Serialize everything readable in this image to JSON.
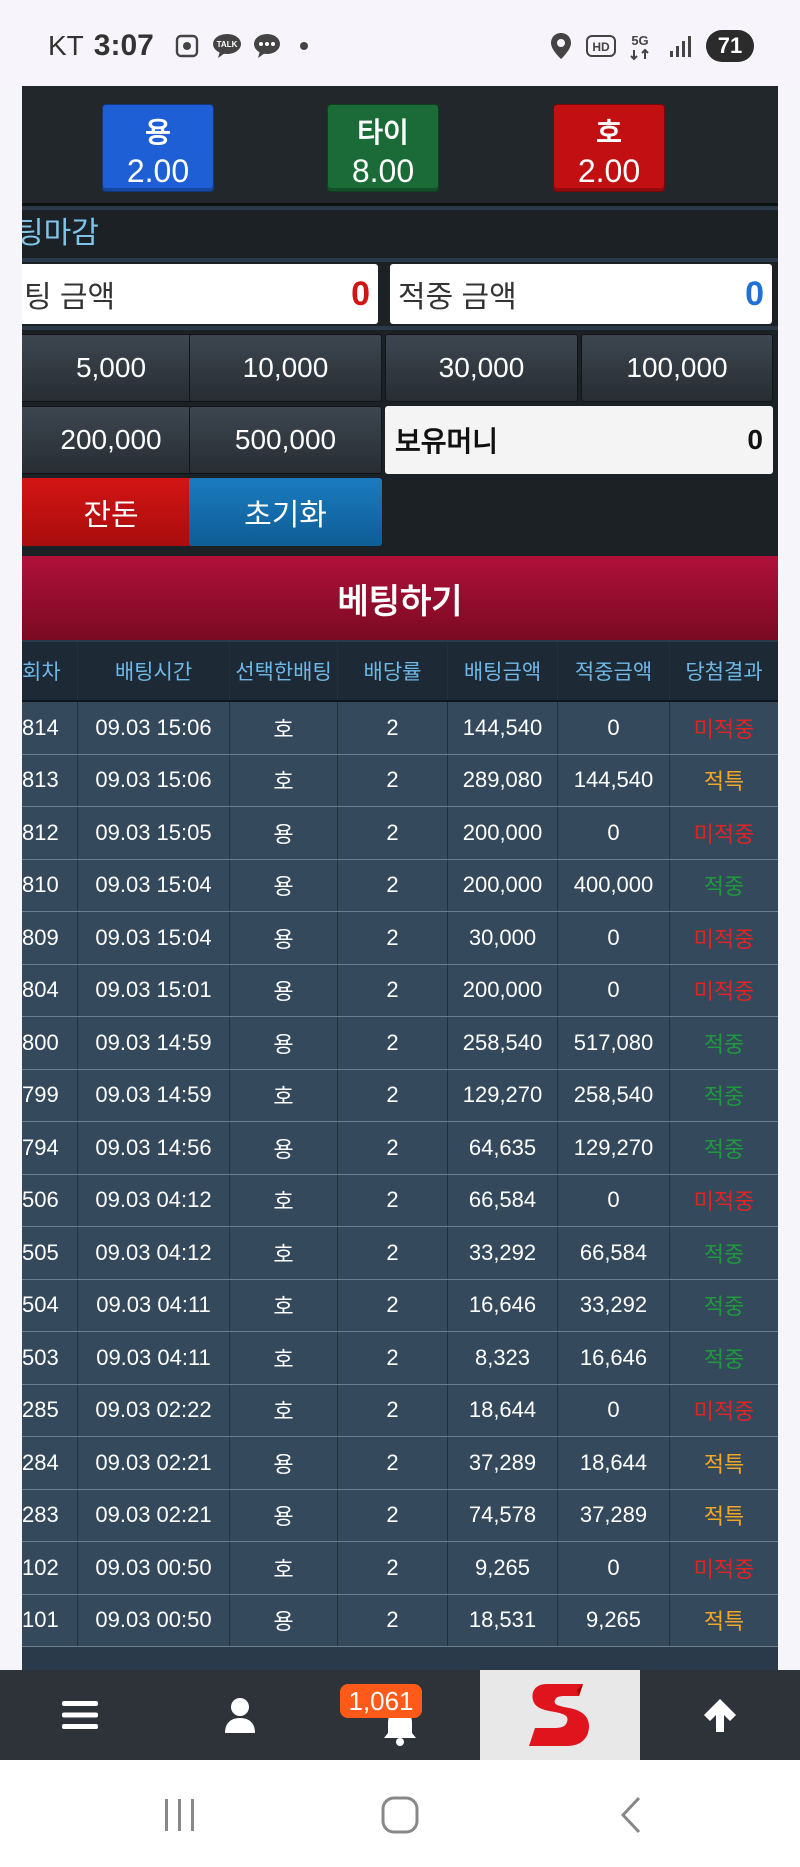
{
  "status_bar": {
    "carrier": "KT",
    "time": "3:07",
    "hd_label": "HD",
    "network_label": "5G",
    "battery": "71",
    "left_icons": [
      "screenshot-icon",
      "kakaotalk-icon",
      "chat-icon"
    ],
    "right_icons": [
      "location-icon",
      "hd-icon",
      "5g-icon",
      "signal-icon",
      "battery-icon"
    ]
  },
  "bet_select": {
    "dragon": {
      "label": "용",
      "odds": "2.00",
      "color": "#1e5fd6"
    },
    "tie": {
      "label": "타이",
      "odds": "8.00",
      "color": "#1a6b38"
    },
    "tiger": {
      "label": "호",
      "odds": "2.00",
      "color": "#c20f12"
    }
  },
  "deadline_label": "팅마감",
  "amounts": {
    "bet_label": "팅 금액",
    "bet_value": "0",
    "win_label": "적중 금액",
    "win_value": "0"
  },
  "chips": [
    "5,000",
    "10,000",
    "30,000",
    "100,000",
    "200,000",
    "500,000"
  ],
  "balance": {
    "label": "보유머니",
    "value": "0"
  },
  "actions": {
    "change": "잔돈",
    "reset": "초기화",
    "place_bet": "베팅하기"
  },
  "history": {
    "headers": [
      "회차",
      "배팅시간",
      "선택한배팅",
      "배당률",
      "배팅금액",
      "적중금액",
      "당첨결과"
    ],
    "rows": [
      {
        "round": "814",
        "time": "09.03 15:06",
        "pick": "호",
        "odds": "2",
        "bet": "144,540",
        "win": "0",
        "result": "미적중",
        "type": "lose"
      },
      {
        "round": "813",
        "time": "09.03 15:06",
        "pick": "호",
        "odds": "2",
        "bet": "289,080",
        "win": "144,540",
        "result": "적특",
        "type": "tie"
      },
      {
        "round": "812",
        "time": "09.03 15:05",
        "pick": "용",
        "odds": "2",
        "bet": "200,000",
        "win": "0",
        "result": "미적중",
        "type": "lose"
      },
      {
        "round": "810",
        "time": "09.03 15:04",
        "pick": "용",
        "odds": "2",
        "bet": "200,000",
        "win": "400,000",
        "result": "적중",
        "type": "win"
      },
      {
        "round": "809",
        "time": "09.03 15:04",
        "pick": "용",
        "odds": "2",
        "bet": "30,000",
        "win": "0",
        "result": "미적중",
        "type": "lose"
      },
      {
        "round": "804",
        "time": "09.03 15:01",
        "pick": "용",
        "odds": "2",
        "bet": "200,000",
        "win": "0",
        "result": "미적중",
        "type": "lose"
      },
      {
        "round": "800",
        "time": "09.03 14:59",
        "pick": "용",
        "odds": "2",
        "bet": "258,540",
        "win": "517,080",
        "result": "적중",
        "type": "win"
      },
      {
        "round": "799",
        "time": "09.03 14:59",
        "pick": "호",
        "odds": "2",
        "bet": "129,270",
        "win": "258,540",
        "result": "적중",
        "type": "win"
      },
      {
        "round": "794",
        "time": "09.03 14:56",
        "pick": "용",
        "odds": "2",
        "bet": "64,635",
        "win": "129,270",
        "result": "적중",
        "type": "win"
      },
      {
        "round": "506",
        "time": "09.03 04:12",
        "pick": "호",
        "odds": "2",
        "bet": "66,584",
        "win": "0",
        "result": "미적중",
        "type": "lose"
      },
      {
        "round": "505",
        "time": "09.03 04:12",
        "pick": "호",
        "odds": "2",
        "bet": "33,292",
        "win": "66,584",
        "result": "적중",
        "type": "win"
      },
      {
        "round": "504",
        "time": "09.03 04:11",
        "pick": "호",
        "odds": "2",
        "bet": "16,646",
        "win": "33,292",
        "result": "적중",
        "type": "win"
      },
      {
        "round": "503",
        "time": "09.03 04:11",
        "pick": "호",
        "odds": "2",
        "bet": "8,323",
        "win": "16,646",
        "result": "적중",
        "type": "win"
      },
      {
        "round": "285",
        "time": "09.03 02:22",
        "pick": "호",
        "odds": "2",
        "bet": "18,644",
        "win": "0",
        "result": "미적중",
        "type": "lose"
      },
      {
        "round": "284",
        "time": "09.03 02:21",
        "pick": "용",
        "odds": "2",
        "bet": "37,289",
        "win": "18,644",
        "result": "적특",
        "type": "tie"
      },
      {
        "round": "283",
        "time": "09.03 02:21",
        "pick": "용",
        "odds": "2",
        "bet": "74,578",
        "win": "37,289",
        "result": "적특",
        "type": "tie"
      },
      {
        "round": "102",
        "time": "09.03 00:50",
        "pick": "호",
        "odds": "2",
        "bet": "9,265",
        "win": "0",
        "result": "미적중",
        "type": "lose"
      },
      {
        "round": "101",
        "time": "09.03 00:50",
        "pick": "용",
        "odds": "2",
        "bet": "18,531",
        "win": "9,265",
        "result": "적특",
        "type": "tie"
      }
    ]
  },
  "bottom_nav": {
    "bell_count": "1,061",
    "items": [
      "menu-icon",
      "user-icon",
      "bell-icon",
      "site-logo",
      "arrow-up-icon"
    ]
  },
  "system_nav": [
    "recent-apps-icon",
    "home-icon",
    "back-icon"
  ]
}
